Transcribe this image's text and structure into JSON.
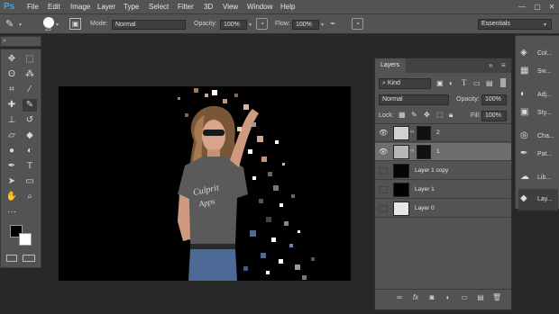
{
  "app": {
    "logo": "Ps"
  },
  "menubar": [
    "File",
    "Edit",
    "Image",
    "Layer",
    "Type",
    "Select",
    "Filter",
    "3D",
    "View",
    "Window",
    "Help"
  ],
  "options": {
    "brush_size": "25",
    "mode_label": "Mode:",
    "mode_value": "Normal",
    "opacity_label": "Opacity:",
    "opacity_value": "100%",
    "flow_label": "Flow:",
    "flow_value": "100%",
    "workspace": "Essentials"
  },
  "layers_panel": {
    "title": "Layers",
    "filter_value": "Kind",
    "blend_mode": "Normal",
    "opacity_label": "Opacity:",
    "opacity_value": "100%",
    "lock_label": "Lock:",
    "fill_label": "Fill:",
    "fill_value": "100%",
    "layers": [
      {
        "name": "2",
        "visible": true,
        "selected": false
      },
      {
        "name": "1",
        "visible": true,
        "selected": true
      },
      {
        "name": "Layer 1 copy",
        "visible": false,
        "selected": false
      },
      {
        "name": "Layer 1",
        "visible": false,
        "selected": false
      },
      {
        "name": "Layer 0",
        "visible": false,
        "selected": false
      }
    ],
    "footer_fx": "fx"
  },
  "panel_strip": [
    "Col...",
    "Sw...",
    "Adj...",
    "Sty...",
    "Cha...",
    "Pat...",
    "Lib...",
    "Lay..."
  ],
  "colors": {
    "ui_bg": "#535353",
    "workspace_bg": "#282828",
    "accent": "#31a8ff",
    "selected_layer": "#6e6e6e"
  }
}
